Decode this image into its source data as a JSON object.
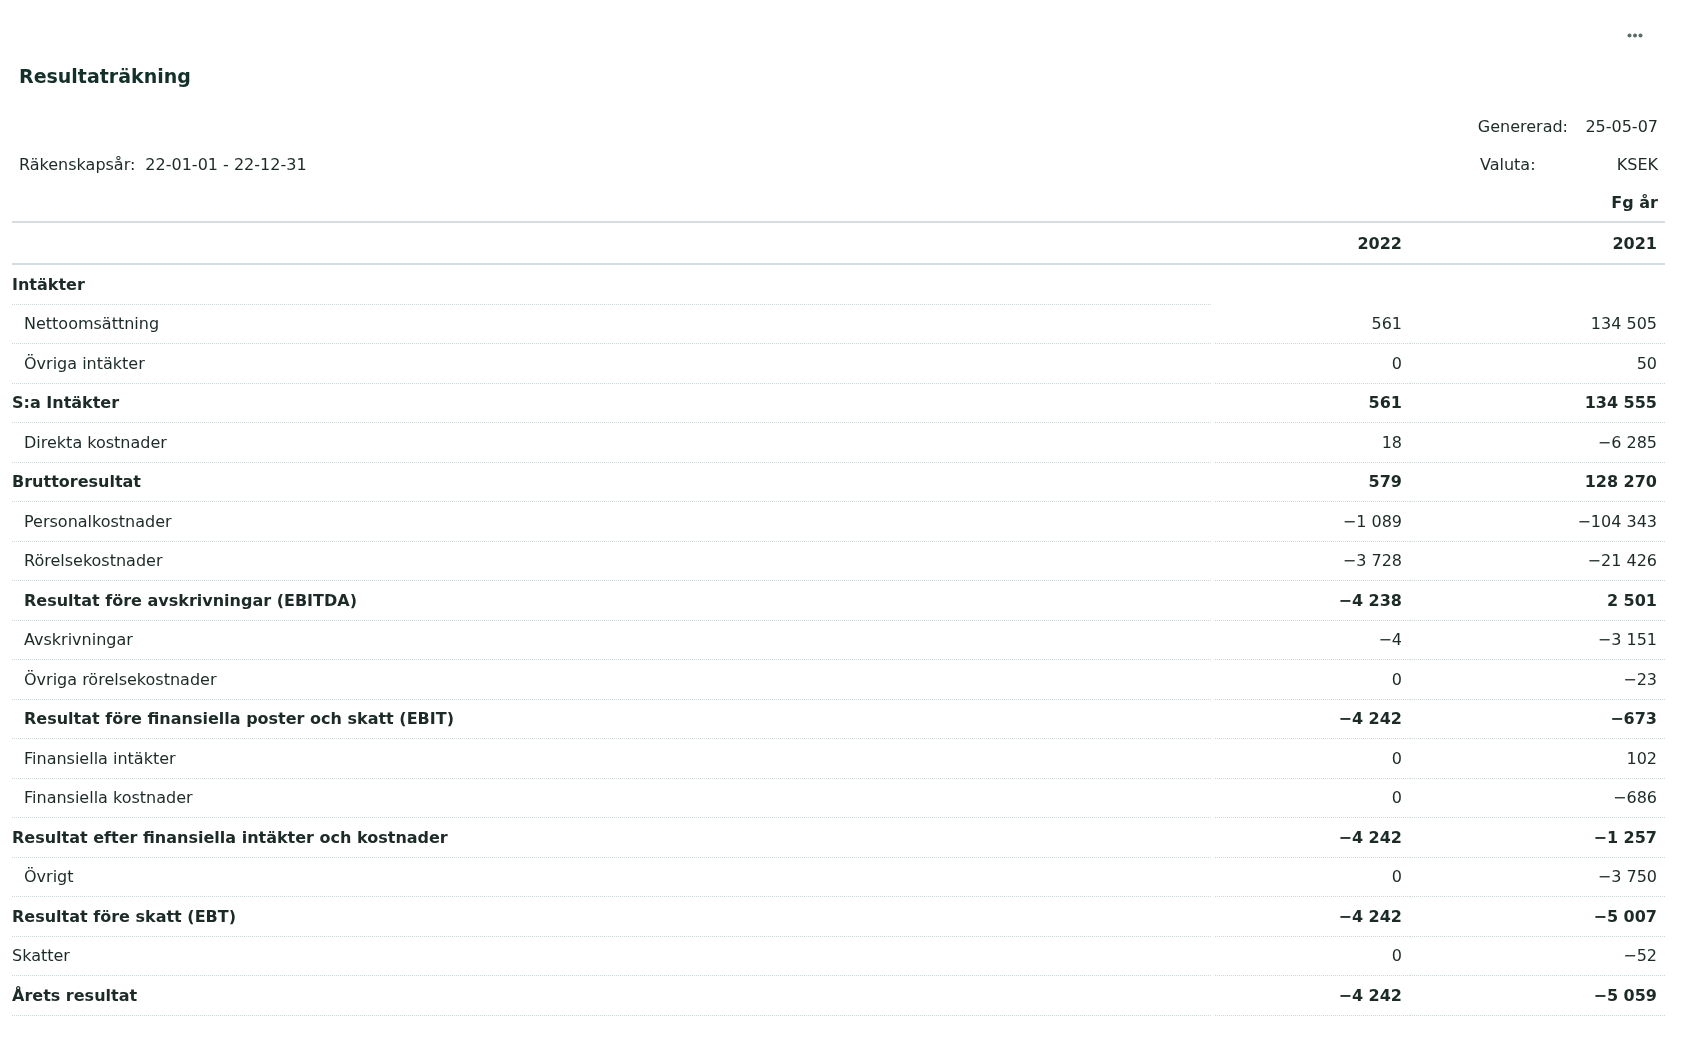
{
  "title": "Resultaträkning",
  "meta": {
    "period_label": "Räkenskapsår:",
    "period": "22-01-01 - 22-12-31",
    "generated_label": "Genererad:",
    "generated": "25-05-07",
    "currency_label": "Valuta:",
    "currency": "KSEK"
  },
  "columns": [
    {
      "label": "2022"
    },
    {
      "label": "2021",
      "caption": "Fg år"
    }
  ],
  "rows": [
    {
      "label": "Intäkter",
      "kind": "total",
      "values": []
    },
    {
      "label": "Nettoomsättning",
      "kind": "item",
      "values": [
        "561",
        "134 505"
      ]
    },
    {
      "label": "Övriga intäkter",
      "kind": "item",
      "values": [
        "0",
        "50"
      ]
    },
    {
      "label": "S:a Intäkter",
      "kind": "total",
      "values": [
        "561",
        "134 555"
      ]
    },
    {
      "label": "Direkta kostnader",
      "kind": "item",
      "values": [
        "18",
        "−6 285"
      ]
    },
    {
      "label": "Bruttoresultat",
      "kind": "total",
      "values": [
        "579",
        "128 270"
      ]
    },
    {
      "label": "Personalkostnader",
      "kind": "item",
      "values": [
        "−1 089",
        "−104 343"
      ]
    },
    {
      "label": "Rörelsekostnader",
      "kind": "item",
      "values": [
        "−3 728",
        "−21 426"
      ]
    },
    {
      "label": "Resultat före avskrivningar (EBITDA)",
      "kind": "subtotal",
      "values": [
        "−4 238",
        "2 501"
      ]
    },
    {
      "label": "Avskrivningar",
      "kind": "item",
      "values": [
        "−4",
        "−3 151"
      ]
    },
    {
      "label": "Övriga rörelsekostnader",
      "kind": "item",
      "values": [
        "0",
        "−23"
      ]
    },
    {
      "label": "Resultat före finansiella poster och skatt (EBIT)",
      "kind": "subtotal",
      "values": [
        "−4 242",
        "−673"
      ]
    },
    {
      "label": "Finansiella intäkter",
      "kind": "item",
      "values": [
        "0",
        "102"
      ]
    },
    {
      "label": "Finansiella kostnader",
      "kind": "item",
      "values": [
        "0",
        "−686"
      ]
    },
    {
      "label": "Resultat efter finansiella intäkter och kostnader",
      "kind": "total",
      "values": [
        "−4 242",
        "−1 257"
      ]
    },
    {
      "label": "Övrigt",
      "kind": "item",
      "values": [
        "0",
        "−3 750"
      ]
    },
    {
      "label": "Resultat före skatt (EBT)",
      "kind": "total",
      "values": [
        "−4 242",
        "−5 007"
      ]
    },
    {
      "label": "Skatter",
      "kind": "plain",
      "values": [
        "0",
        "−52"
      ]
    },
    {
      "label": "Årets resultat",
      "kind": "total",
      "values": [
        "−4 242",
        "−5 059"
      ]
    }
  ]
}
